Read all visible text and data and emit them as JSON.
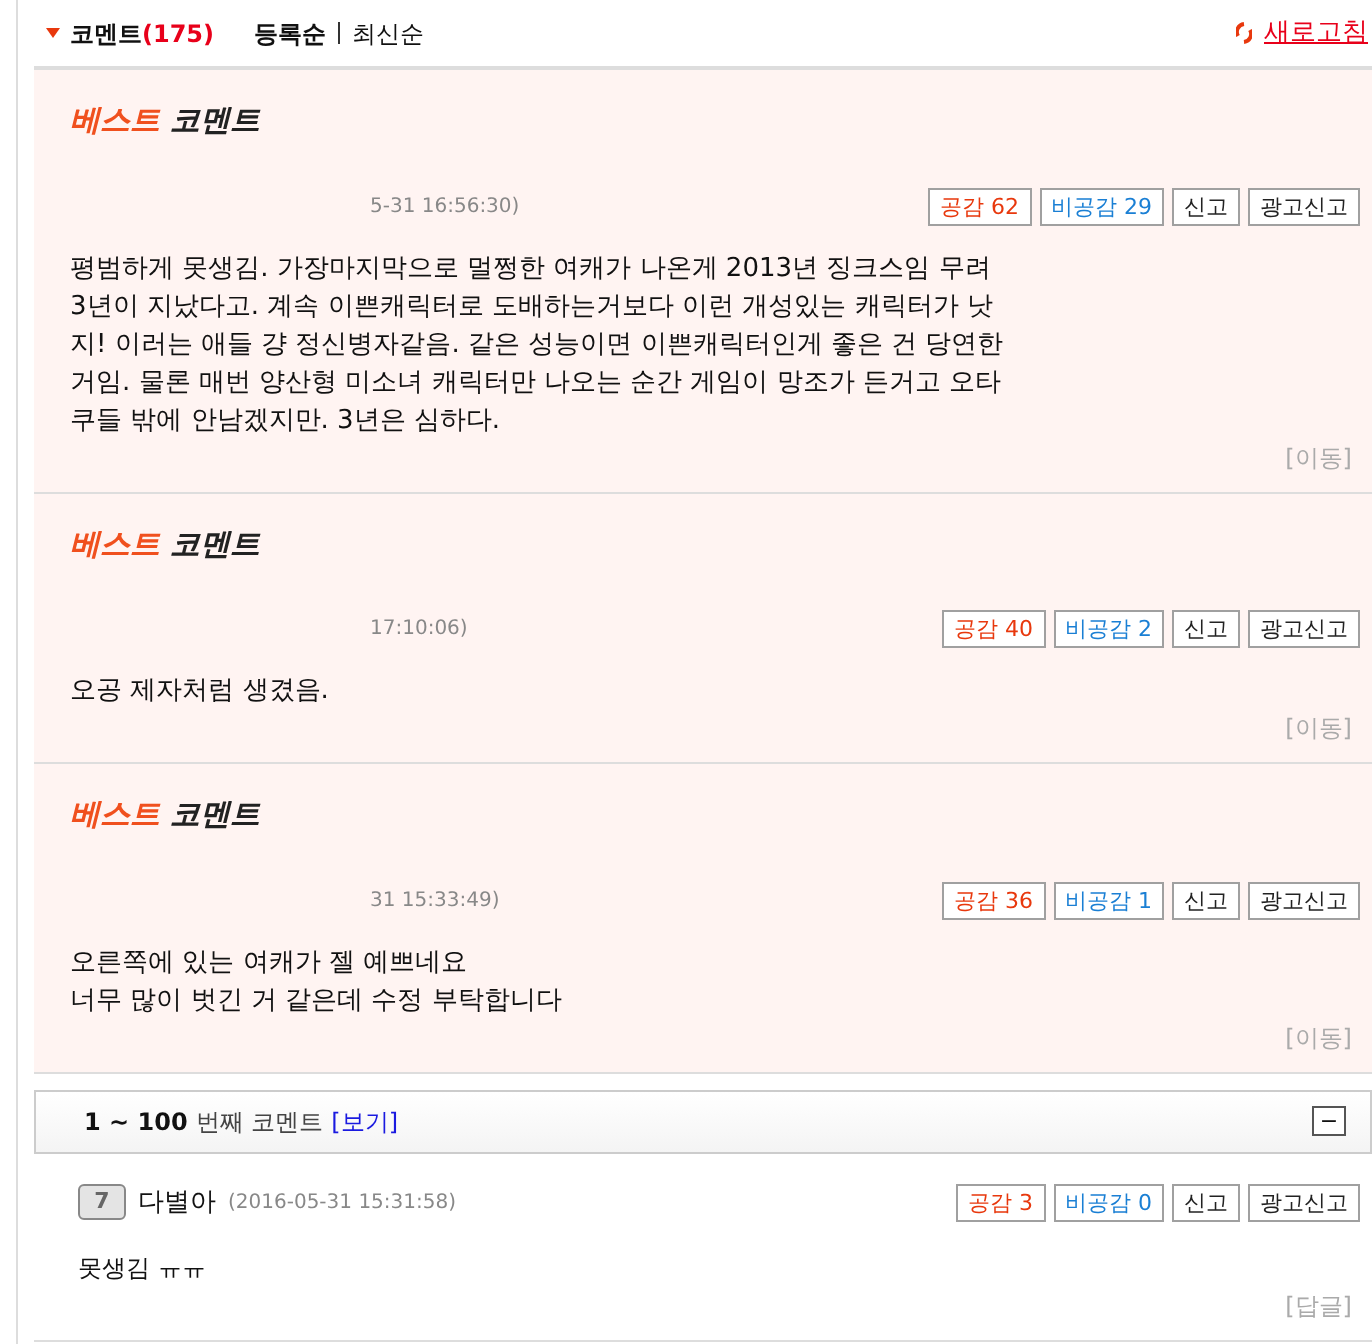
{
  "header": {
    "title": "코멘트",
    "count": "(175)",
    "sort_options": [
      {
        "label": "등록순",
        "selected": true
      },
      {
        "label": "최신순",
        "selected": false
      }
    ],
    "refresh": "새로고침"
  },
  "best_comments": [
    {
      "badge_highlight": "베스트",
      "badge_rest": "코멘트",
      "time": "5-31 16:56:30)",
      "like": "공감 62",
      "dislike": "비공감 29",
      "report": "신고",
      "ad_report": "광고신고",
      "body": "평범하게 못생김. 가장마지막으로 멀쩡한 여캐가 나온게 2013년 징크스임 무려 3년이 지났다고. 계속 이쁜캐릭터로 도배하는거보다 이런 개성있는 캐릭터가 낫지! 이러는 애들 걍 정신병자같음. 같은 성능이면 이쁜캐릭터인게 좋은 건 당연한거임. 물론 매번 양산형 미소녀 캐릭터만 나오는 순간 게임이 망조가 든거고 오타쿠들 밖에 안남겠지만. 3년은 심하다.",
      "action": "[이동]"
    },
    {
      "badge_highlight": "베스트",
      "badge_rest": "코멘트",
      "time": "17:10:06)",
      "like": "공감 40",
      "dislike": "비공감 2",
      "report": "신고",
      "ad_report": "광고신고",
      "body": "오공 제자처럼 생겼음.",
      "action": "[이동]"
    },
    {
      "badge_highlight": "베스트",
      "badge_rest": "코멘트",
      "time": "31 15:33:49)",
      "like": "공감 36",
      "dislike": "비공감 1",
      "report": "신고",
      "ad_report": "광고신고",
      "body": "오른쪽에 있는 여캐가 젤 예쁘네요\n너무 많이 벗긴 거 같은데 수정 부탁합니다",
      "action": "[이동]"
    }
  ],
  "pager": {
    "range": "1 ~ 100",
    "label": "번째 코멘트",
    "link": "[보기]",
    "toggle": "−"
  },
  "comments": [
    {
      "level": "7",
      "author": "다별아",
      "time": "(2016-05-31 15:31:58)",
      "like": "공감 3",
      "dislike": "비공감 0",
      "report": "신고",
      "ad_report": "광고신고",
      "body": "못생김 ㅠㅠ",
      "action": "[답글]"
    }
  ]
}
